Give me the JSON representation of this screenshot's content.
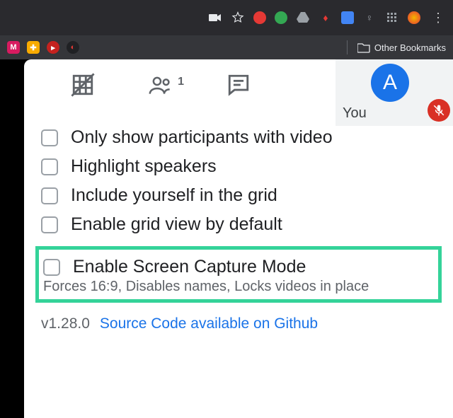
{
  "chrome": {
    "other_bookmarks": "Other Bookmarks"
  },
  "self": {
    "label": "You",
    "avatar_initial": "A"
  },
  "people_badge": "1",
  "options": [
    {
      "label": "Only show participants with video"
    },
    {
      "label": "Highlight speakers"
    },
    {
      "label": "Include yourself in the grid"
    },
    {
      "label": "Enable grid view by default"
    }
  ],
  "highlight": {
    "label": "Enable Screen Capture Mode",
    "sub": "Forces 16:9, Disables names, Locks videos in place"
  },
  "footer": {
    "version": "v1.28.0",
    "source_link": "Source Code available on Github"
  }
}
